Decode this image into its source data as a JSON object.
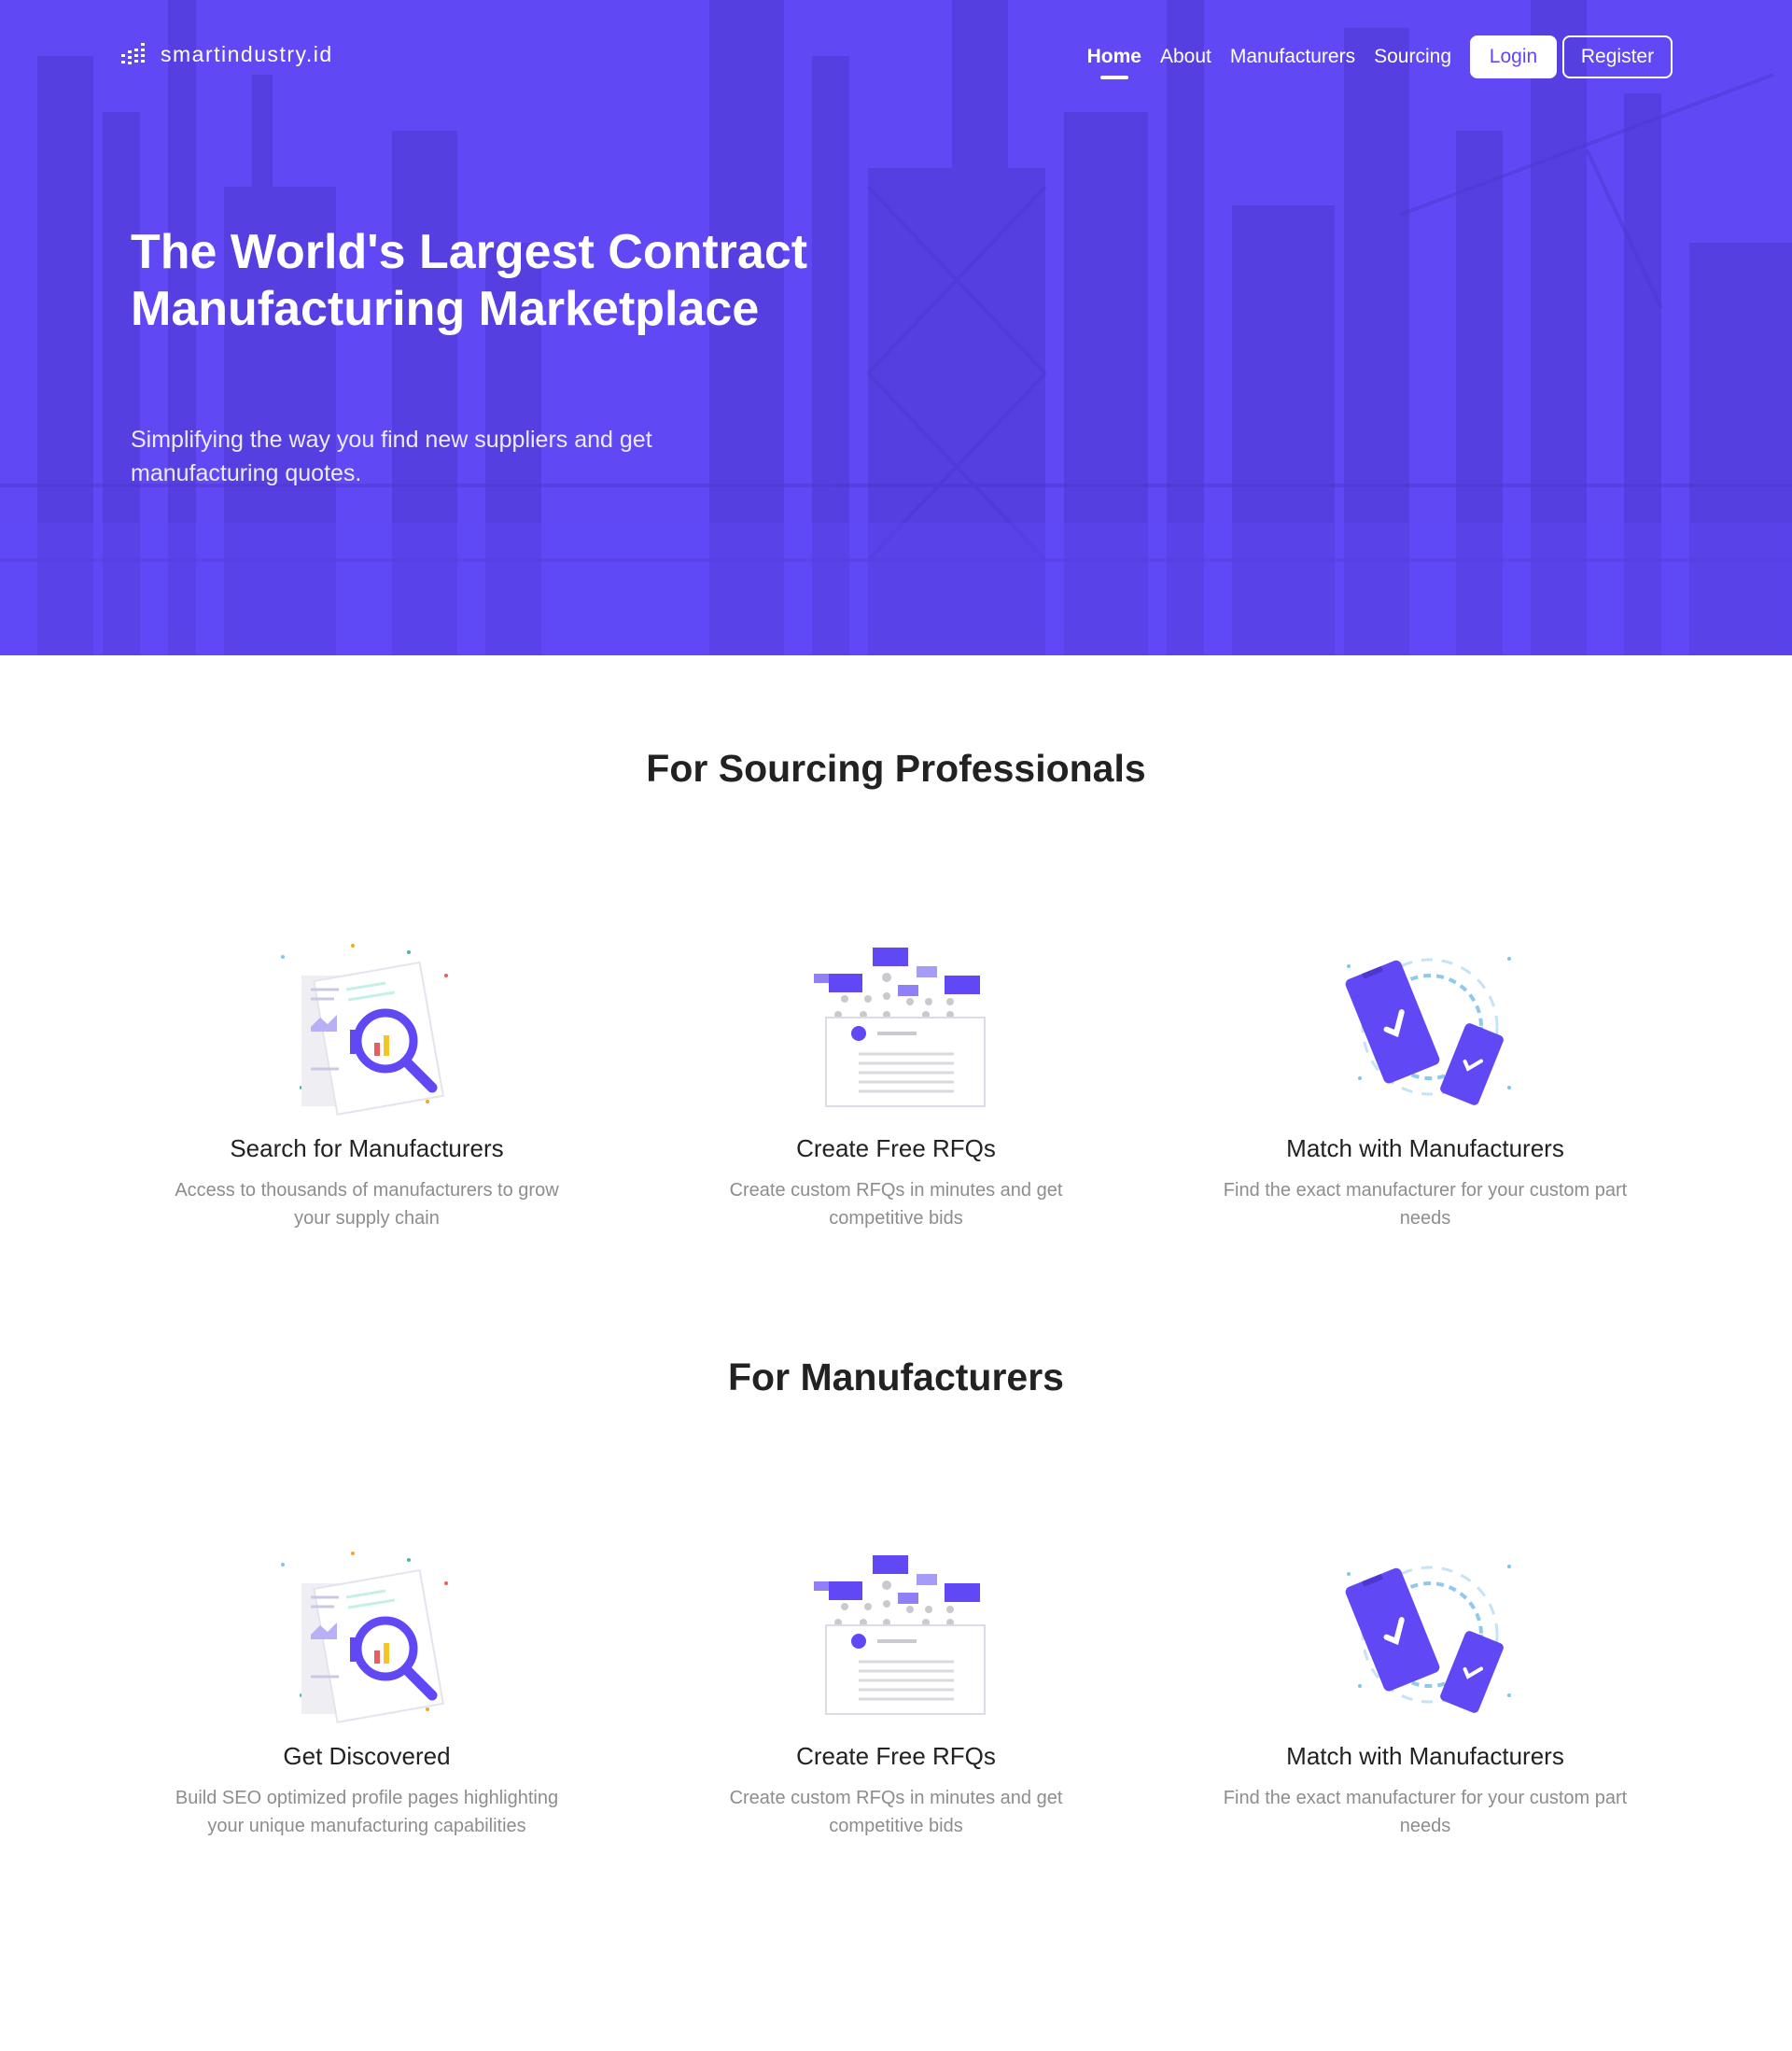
{
  "brand": {
    "name": "smartindustry.id"
  },
  "nav": {
    "links": [
      {
        "label": "Home"
      },
      {
        "label": "About"
      },
      {
        "label": "Manufacturers"
      },
      {
        "label": "Sourcing"
      }
    ],
    "login_label": "Login",
    "register_label": "Register"
  },
  "hero": {
    "title": "The World's Largest Contract Manufacturing Marketplace",
    "subtitle": "Simplifying the way you find new suppliers and get manufacturing quotes."
  },
  "sourcing": {
    "title": "For Sourcing Professionals",
    "features": [
      {
        "icon": "search-documents-icon",
        "title": "Search for Manufacturers",
        "text": "Access to thousands of manufacturers to grow your supply chain"
      },
      {
        "icon": "rfq-form-icon",
        "title": "Create Free RFQs",
        "text": "Create custom RFQs in minutes and get competitive bids"
      },
      {
        "icon": "matching-phones-icon",
        "title": "Match with Manufacturers",
        "text": "Find the exact manufacturer for your custom part needs"
      }
    ]
  },
  "manufacturers": {
    "title": "For Manufacturers",
    "features": [
      {
        "icon": "search-documents-icon",
        "title": "Get Discovered",
        "text": "Build SEO optimized profile pages highlighting your unique manufacturing capabilities"
      },
      {
        "icon": "rfq-form-icon",
        "title": "Create Free RFQs",
        "text": "Create custom RFQs in minutes and get competitive bids"
      },
      {
        "icon": "matching-phones-icon",
        "title": "Match with Manufacturers",
        "text": "Find the exact manufacturer for your custom part needs"
      }
    ]
  },
  "colors": {
    "primary": "#6049f5",
    "heading": "#222222",
    "muted": "#8d8d8d"
  }
}
